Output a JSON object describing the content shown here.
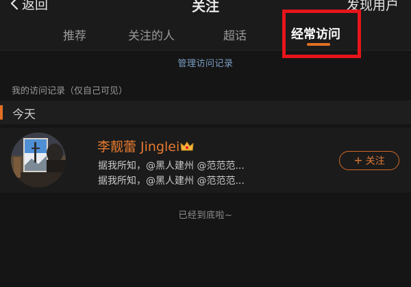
{
  "nav": {
    "back_label": "返回",
    "title": "关注",
    "discover_label": "发现用户"
  },
  "tabs": [
    {
      "label": "推荐",
      "active": false
    },
    {
      "label": "关注的人",
      "active": false
    },
    {
      "label": "超话",
      "active": false
    },
    {
      "label": "经常访问",
      "active": true
    }
  ],
  "manage_link": "管理访问记录",
  "section_label": "我的访问记录（仅自己可见）",
  "group_header": "今天",
  "visit": {
    "name": "李靓蕾 Jinglei",
    "line1": "据我所知，@黑人建州 @范范范...",
    "line2": "据我所知，@黑人建州 @范范范...",
    "follow_label": "关注"
  },
  "end_text": "已经到底啦~",
  "colors": {
    "accent": "#e36f24",
    "highlight": "#e8141b",
    "link": "#7b9fc6",
    "background": "#151515"
  }
}
